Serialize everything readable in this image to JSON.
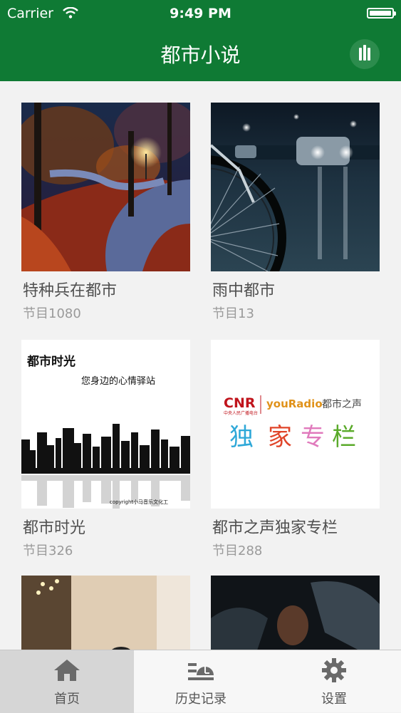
{
  "status_bar": {
    "carrier": "Carrier",
    "time": "9:49 PM"
  },
  "nav": {
    "title": "都市小说",
    "right_icon": "equalizer-icon"
  },
  "albums": [
    {
      "title": "特种兵在都市",
      "count": "节目1080",
      "image": "autumn-park-night-photo"
    },
    {
      "title": "雨中都市",
      "count": "节目13",
      "image": "rainy-street-bicycle-photo"
    },
    {
      "title": "都市时光",
      "count": "节目326",
      "image": "city-skyline-cover",
      "cover": {
        "heading": "都市时光",
        "subheading": "您身边的心情驿站",
        "copyright": "copyright小马音乐文化工"
      }
    },
    {
      "title": "都市之声独家专栏",
      "count": "节目288",
      "image": "cnr-youradio-cover",
      "cover": {
        "brand_cnr": "CNR",
        "brand_cnr_sub": "中央人民广播电台",
        "brand_youradio": "youRadio",
        "brand_station": "都市之声",
        "tagline": [
          "独",
          "家",
          "专",
          "栏"
        ]
      }
    },
    {
      "image": "interior-room-photo"
    },
    {
      "image": "dark-portrait-photo"
    }
  ],
  "tab_bar": {
    "tabs": [
      {
        "label": "首页",
        "icon": "home-icon",
        "active": true
      },
      {
        "label": "历史记录",
        "icon": "history-icon",
        "active": false
      },
      {
        "label": "设置",
        "icon": "gear-icon",
        "active": false
      }
    ]
  },
  "colors": {
    "brand_green": "#0f7a34",
    "tab_active_bg": "#d6d6d6"
  }
}
